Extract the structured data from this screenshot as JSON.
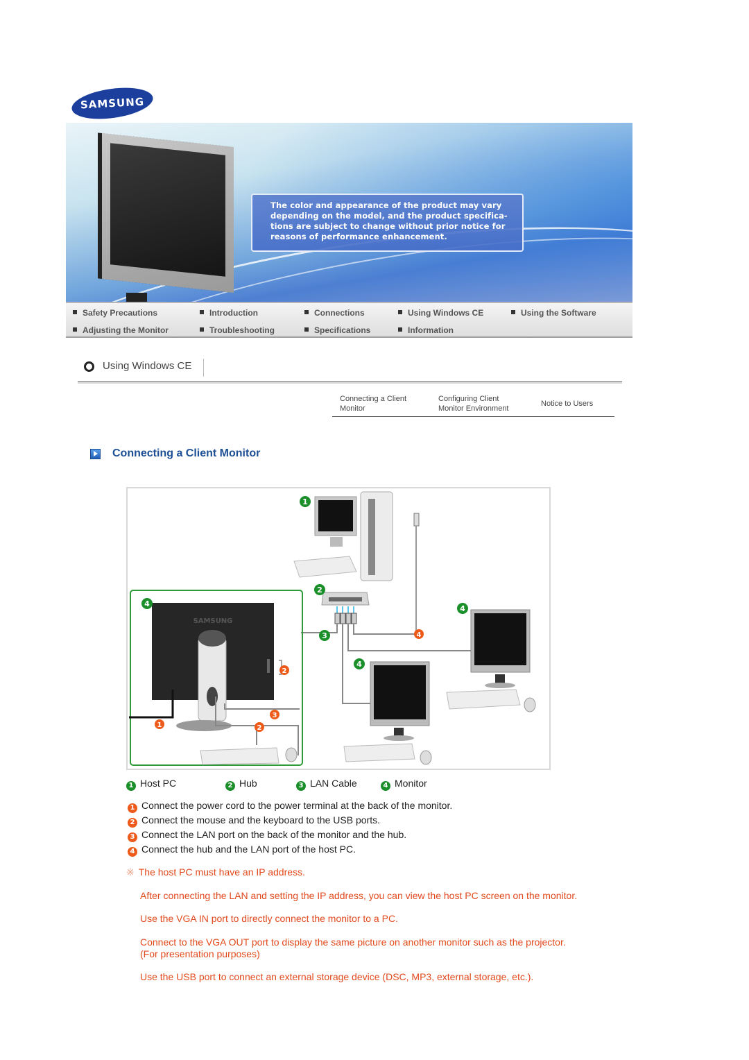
{
  "brand": {
    "logo_text": "SAMSUNG",
    "logo_color": "#1c3f9e"
  },
  "banner": {
    "notice": "The color and appearance of the product may vary depending on the model, and the product specifica- tions are subject to change without prior notice for reasons of performance enhancement.",
    "notice_lines": [
      "The color and appearance of the product may vary",
      "depending on the model, and the product specifica-",
      "tions are subject to change without prior notice for",
      "reasons of performance enhancement."
    ]
  },
  "nav": {
    "items": [
      {
        "label": "Safety Precautions"
      },
      {
        "label": "Introduction"
      },
      {
        "label": "Connections"
      },
      {
        "label": "Using Windows CE"
      },
      {
        "label": "Using the Software"
      },
      {
        "label": "Adjusting the Monitor"
      },
      {
        "label": "Troubleshooting"
      },
      {
        "label": "Specifications"
      },
      {
        "label": "Information"
      }
    ]
  },
  "section": {
    "title": "Using Windows CE"
  },
  "subtabs": [
    {
      "line1": "Connecting a Client",
      "line2": "Monitor"
    },
    {
      "line1": "Configuring Client",
      "line2": "Monitor Environment"
    },
    {
      "line1": "Notice to Users",
      "line2": ""
    }
  ],
  "page_title": "Connecting a Client Monitor",
  "diagram": {
    "callouts_green": [
      "1",
      "2",
      "3",
      "4",
      "4",
      "4",
      "4"
    ],
    "callouts_orange": [
      "1",
      "2",
      "2",
      "3",
      "4"
    ],
    "monitor_brand": "SAMSUNG"
  },
  "legend": [
    {
      "num": "1",
      "label": "Host PC"
    },
    {
      "num": "2",
      "label": "Hub"
    },
    {
      "num": "3",
      "label": "LAN Cable"
    },
    {
      "num": "4",
      "label": "Monitor"
    }
  ],
  "steps": [
    {
      "num": "1",
      "text": "Connect the power cord to the power terminal at the back of the monitor."
    },
    {
      "num": "2",
      "text": "Connect the mouse and the keyboard to the USB ports."
    },
    {
      "num": "3",
      "text": "Connect the LAN port on the back of the monitor and the hub."
    },
    {
      "num": "4",
      "text": "Connect the hub and the LAN port of the host PC."
    }
  ],
  "notes": {
    "ref_mark": "※",
    "items": [
      "The host PC must have an IP address.",
      "After connecting the LAN and setting the IP address, you can view the host PC screen on the monitor.",
      "Use the VGA IN port to directly connect the monitor to a PC.",
      "Connect to the VGA OUT port to display the same picture on another monitor such as the projector. (For presentation purposes)",
      "Use the USB port to connect an external storage device (DSC, MP3, external storage, etc.)."
    ]
  },
  "colors": {
    "title_blue": "#1d4f94",
    "note_orange": "#e2491c",
    "badge_green": "#1a8f2a",
    "badge_orange": "#ee5a1a"
  }
}
